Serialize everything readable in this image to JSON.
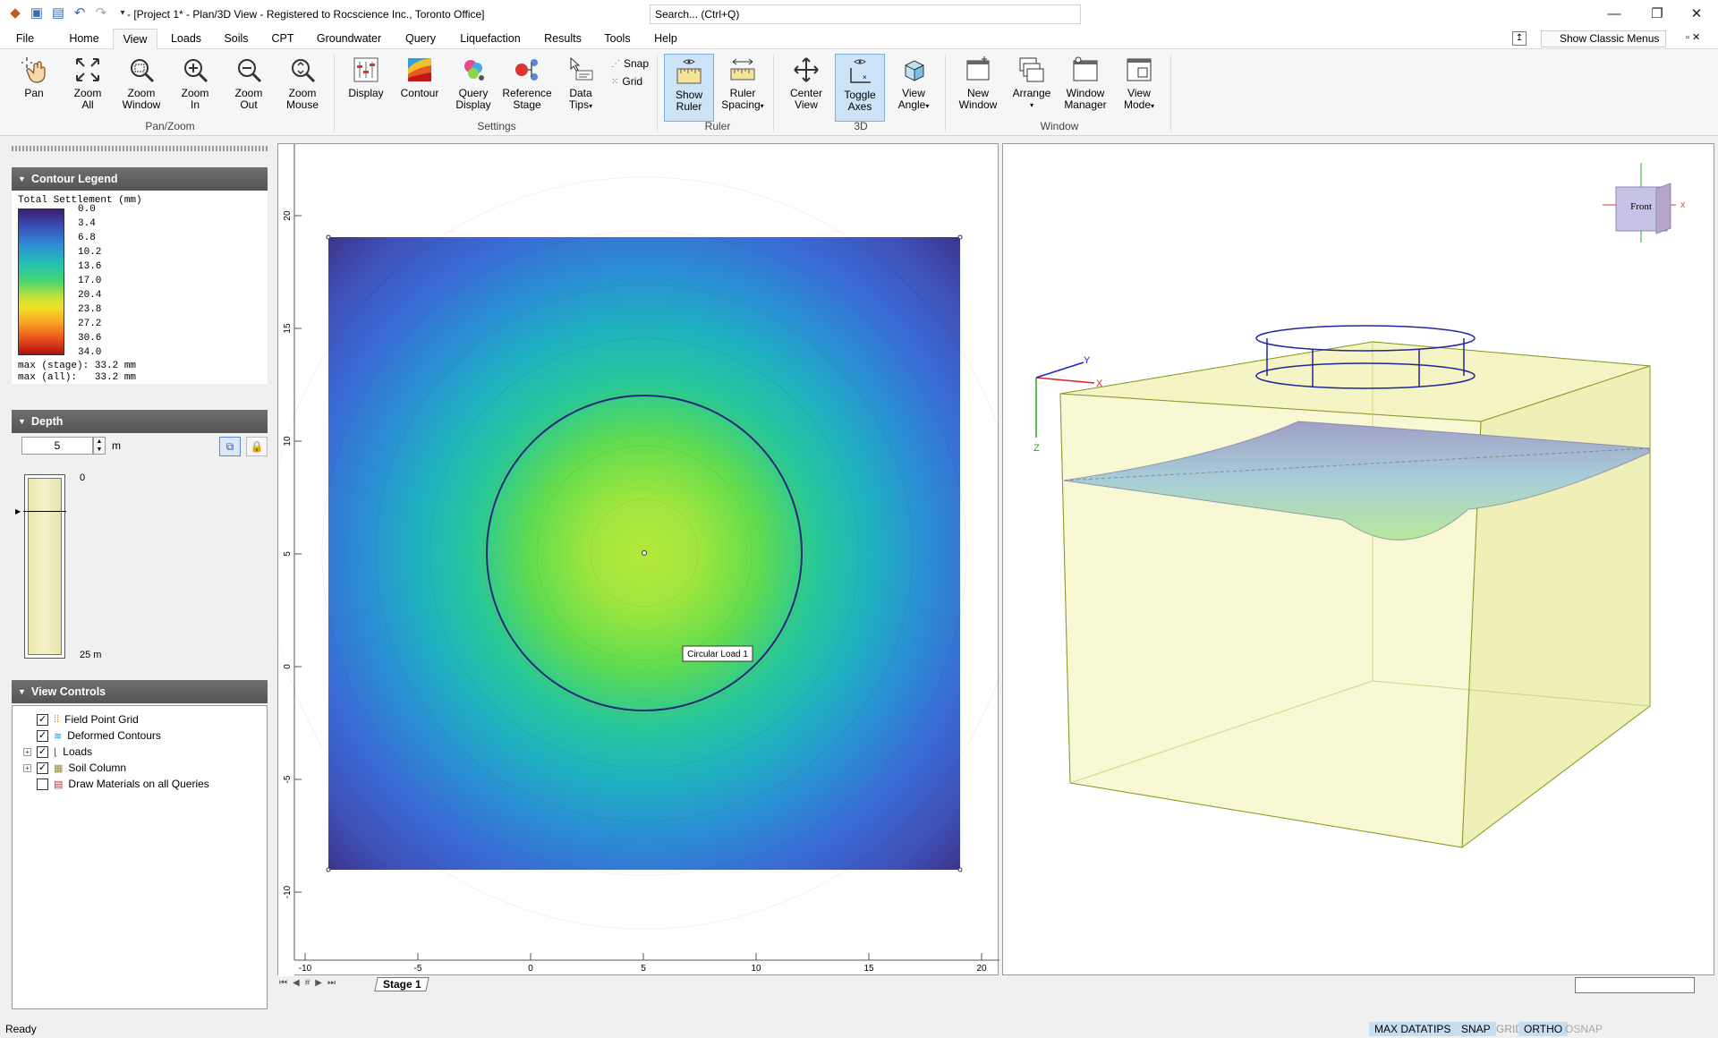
{
  "title_bar": {
    "window_title": "- [Project 1* - Plan/3D View - Registered to Rocscience Inc., Toronto Office]",
    "search_placeholder": "Search... (Ctrl+Q)"
  },
  "menu": {
    "tabs": [
      "File",
      "Home",
      "View",
      "Loads",
      "Soils",
      "CPT",
      "Groundwater",
      "Query",
      "Liquefaction",
      "Results",
      "Tools",
      "Help"
    ],
    "active_tab": "View",
    "show_classic_menus": "Show Classic Menus"
  },
  "ribbon": {
    "pan": "Pan",
    "zoom_all": [
      "Zoom",
      "All"
    ],
    "zoom_window": [
      "Zoom",
      "Window"
    ],
    "zoom_in": [
      "Zoom",
      "In"
    ],
    "zoom_out": [
      "Zoom",
      "Out"
    ],
    "zoom_mouse": [
      "Zoom",
      "Mouse"
    ],
    "group_panzoom": "Pan/Zoom",
    "display": "Display",
    "contour": "Contour",
    "query_display": [
      "Query",
      "Display"
    ],
    "reference_stage": [
      "Reference",
      "Stage"
    ],
    "data_tips": [
      "Data",
      "Tips"
    ],
    "snap": "Snap",
    "grid": "Grid",
    "group_settings": "Settings",
    "show_ruler": [
      "Show",
      "Ruler"
    ],
    "ruler_spacing": [
      "Ruler",
      "Spacing"
    ],
    "group_ruler": "Ruler",
    "center_view": [
      "Center",
      "View"
    ],
    "toggle_axes": [
      "Toggle",
      "Axes"
    ],
    "view_angle": [
      "View",
      "Angle"
    ],
    "group_3d": "3D",
    "new_window": [
      "New",
      "Window"
    ],
    "arrange": "Arrange",
    "window_manager": [
      "Window",
      "Manager"
    ],
    "view_mode": [
      "View",
      "Mode"
    ],
    "group_window": "Window"
  },
  "left_panel": {
    "contour_legend_title": "Contour Legend",
    "legend_quantity": "Total Settlement (mm)",
    "legend_values": [
      "0.0",
      "3.4",
      "6.8",
      "10.2",
      "13.6",
      "17.0",
      "20.4",
      "23.8",
      "27.2",
      "30.6",
      "34.0"
    ],
    "max_stage": "max (stage): 33.2 mm",
    "max_all": "max (all):   33.2 mm",
    "depth_title": "Depth",
    "depth_value": "5",
    "depth_unit": "m",
    "column_top": "0",
    "column_bottom": "25 m",
    "view_controls_title": "View Controls",
    "view_controls": [
      {
        "label": "Field Point Grid",
        "checked": true,
        "expandable": false
      },
      {
        "label": "Deformed Contours",
        "checked": true,
        "expandable": false
      },
      {
        "label": "Loads",
        "checked": true,
        "expandable": true
      },
      {
        "label": "Soil Column",
        "checked": true,
        "expandable": true
      },
      {
        "label": "Draw Materials on all Queries",
        "checked": false,
        "expandable": false
      }
    ]
  },
  "plan_view": {
    "x_ticks": [
      "-10",
      "-5",
      "0",
      "5",
      "10",
      "15",
      "20"
    ],
    "y_ticks": [
      "20",
      "15",
      "10",
      "5",
      "0",
      "-5",
      "-10"
    ],
    "load_label": "Circular Load 1"
  },
  "view3d": {
    "cube_face": "Front",
    "axis_x": "X",
    "axis_y": "Y",
    "axis_z": "Z"
  },
  "stage_tab": "Stage 1",
  "status": {
    "ready": "Ready",
    "max_datatips": "MAX DATATIPS",
    "snap": "SNAP",
    "grid": "GRID",
    "ortho": "ORTHO",
    "osnap": "OSNAP"
  }
}
